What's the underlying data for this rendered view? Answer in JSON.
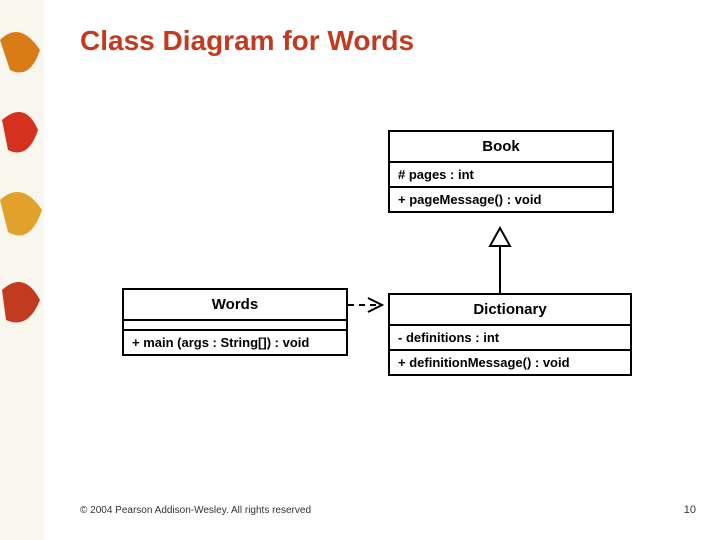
{
  "title": "Class Diagram for Words",
  "classes": {
    "book": {
      "name": "Book",
      "attributes": [
        "# pages : int"
      ],
      "methods": [
        "+ pageMessage() : void"
      ]
    },
    "words": {
      "name": "Words",
      "attributes": [],
      "methods": [
        "+ main (args : String[]) : void"
      ]
    },
    "dictionary": {
      "name": "Dictionary",
      "attributes": [
        "- definitions : int"
      ],
      "methods": [
        "+ definitionMessage() : void"
      ]
    }
  },
  "footer": {
    "copyright": "© 2004 Pearson Addison-Wesley. All rights reserved",
    "page": "10"
  },
  "colors": {
    "title": "#c23a1f",
    "border": "#000000"
  }
}
